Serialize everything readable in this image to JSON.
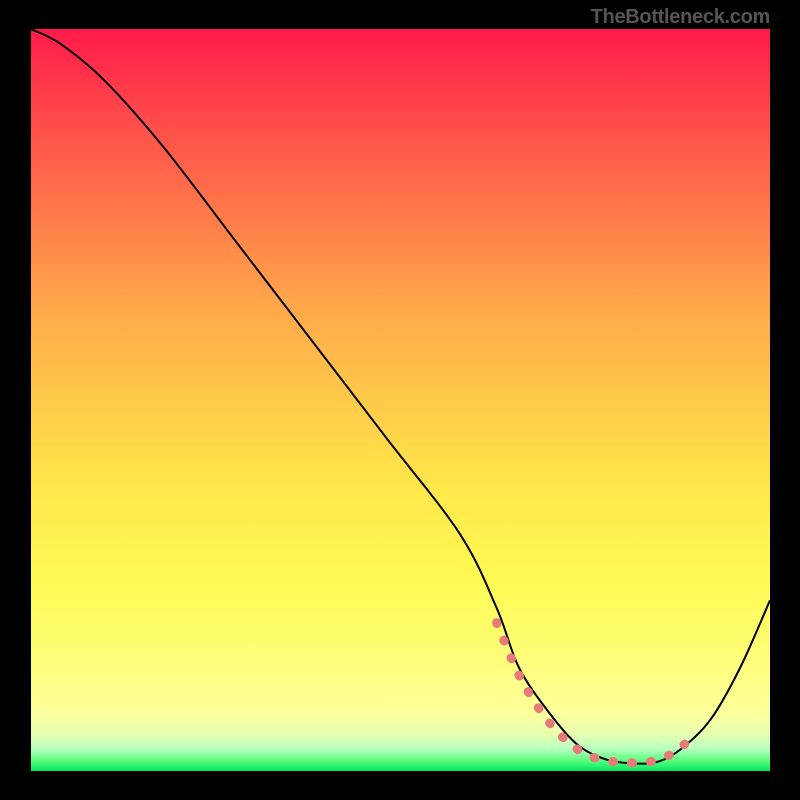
{
  "attribution": "TheBottleneck.com",
  "chart_data": {
    "type": "line",
    "title": "",
    "xlabel": "",
    "ylabel": "",
    "xlim": [
      0,
      100
    ],
    "ylim": [
      0,
      100
    ],
    "series": [
      {
        "name": "bottleneck-curve",
        "x": [
          0,
          4,
          10,
          18,
          28,
          38,
          48,
          58,
          63,
          66,
          70,
          74,
          78,
          82,
          85,
          88,
          92,
          96,
          100
        ],
        "y": [
          100,
          98,
          93,
          84,
          71,
          58,
          45,
          32,
          22,
          14,
          8,
          3.5,
          1.5,
          1,
          1.3,
          3,
          7,
          14,
          23
        ]
      }
    ],
    "marker_points": {
      "name": "highlighted-range",
      "x": [
        63,
        66,
        69,
        72,
        75,
        78,
        81,
        84,
        87,
        90
      ],
      "y": [
        20,
        13,
        8,
        4.5,
        2.3,
        1.4,
        1.1,
        1.3,
        2.5,
        5
      ]
    }
  }
}
